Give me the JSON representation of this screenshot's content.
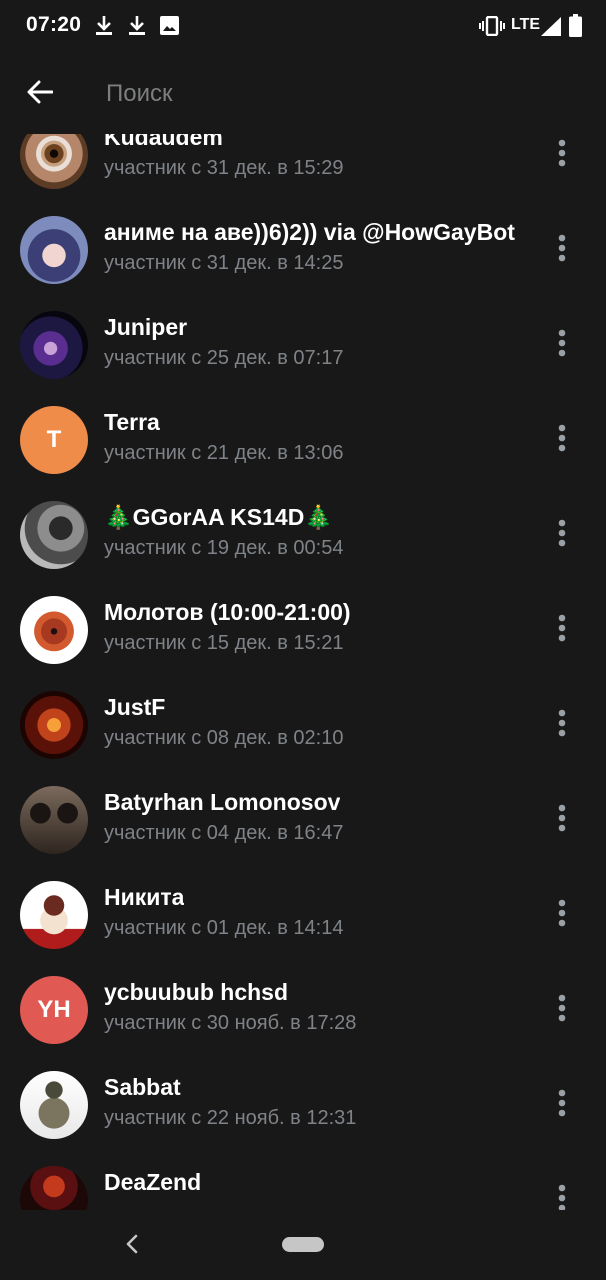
{
  "status_bar": {
    "time": "07:20",
    "left_icons": [
      "download-icon",
      "download-icon",
      "image-icon"
    ],
    "network_label": "LTE",
    "right_icons": [
      "vibrate-icon",
      "signal-icon",
      "battery-icon"
    ]
  },
  "app_bar": {
    "back_icon": "arrow-left-icon",
    "search_placeholder": "Поиск",
    "search_value": ""
  },
  "members": [
    {
      "name": "Kudaudem",
      "status": "участник с 31 дек. в 15:29",
      "avatar": "photo-eye",
      "avatar_color": "#3a2a1c"
    },
    {
      "name": "аниме на аве))6)2)) via @HowGayBot",
      "status": "участник с 31 дек. в 14:25",
      "avatar": "photo-anime",
      "avatar_color": "#6b78a8"
    },
    {
      "name": "Juniper",
      "status": "участник с 25 дек. в 07:17",
      "avatar": "photo-dark-anime",
      "avatar_color": "#141230"
    },
    {
      "name": "Terra",
      "status": "участник с 21 дек. в 13:06",
      "avatar_initials": "T",
      "avatar_color": "#ef8c4a"
    },
    {
      "name": "🎄GGorAA KS14D🎄",
      "status": "участник с 19 дек. в 00:54",
      "avatar": "photo-helmet",
      "avatar_color": "#6f6f6f"
    },
    {
      "name": "Молотов (10:00-21:00)",
      "status": "участник с 15 дек. в 15:21",
      "avatar": "photo-bear",
      "avatar_color": "#ffffff"
    },
    {
      "name": "JustF",
      "status": "участник с 08 дек. в 02:10",
      "avatar": "photo-fire-letter",
      "avatar_color": "#3a0804"
    },
    {
      "name": "Batyrhan Lomonosov",
      "status": "участник с 04 дек. в 16:47",
      "avatar": "photo-silhouettes",
      "avatar_color": "#2c241f"
    },
    {
      "name": "Никита",
      "status": "участник с 01 дек. в 14:14",
      "avatar": "photo-cartoon-boy",
      "avatar_color": "#ffffff"
    },
    {
      "name": "ycbuubub hchsd",
      "status": "участник с 30 нояб. в 17:28",
      "avatar_initials": "YH",
      "avatar_color": "#e05a53"
    },
    {
      "name": "Sabbat",
      "status": "участник с 22 нояб. в 12:31",
      "avatar": "photo-soldier",
      "avatar_color": "#ffffff"
    },
    {
      "name": "DeaZend",
      "status": "",
      "avatar": "photo-red-dark",
      "avatar_color": "#5a1010"
    }
  ],
  "nav_bar": {
    "back_icon": "nav-back-chevron-icon",
    "home_icon": "home-pill-icon"
  }
}
